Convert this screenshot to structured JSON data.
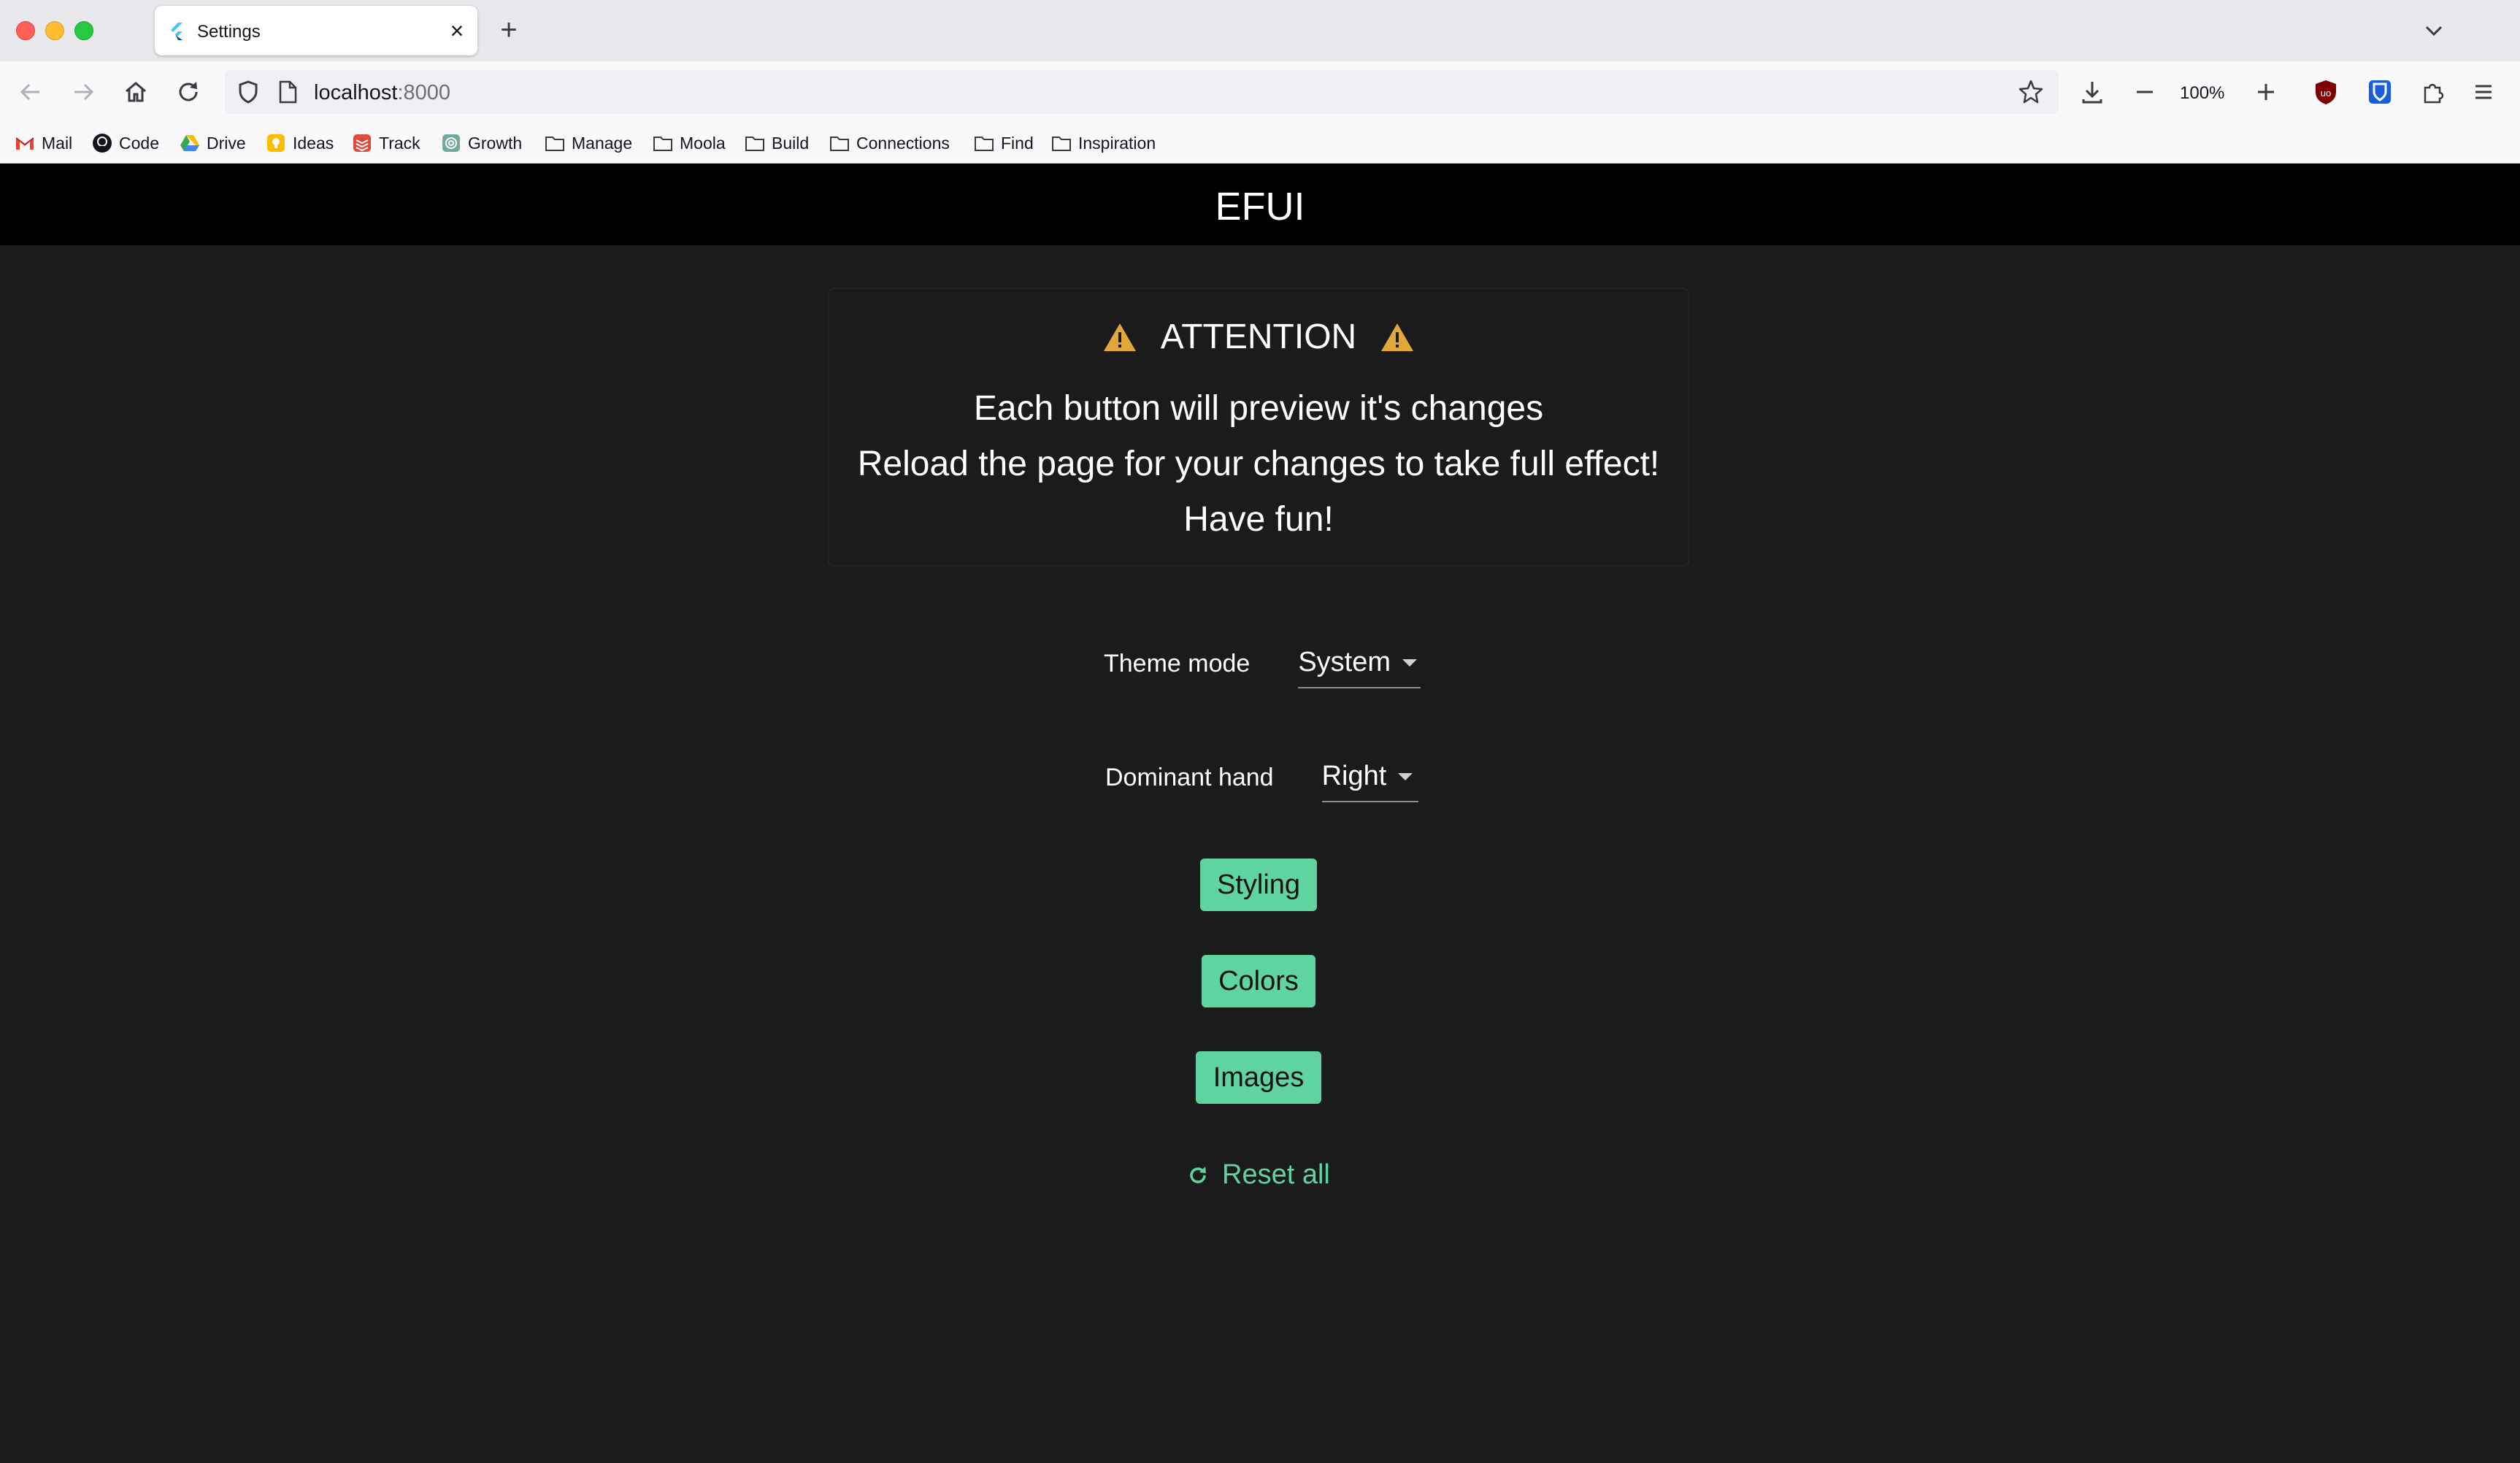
{
  "browser": {
    "tab_title": "Settings",
    "url_host": "localhost",
    "url_port": ":8000",
    "zoom": "100%",
    "bookmarks": [
      "Mail",
      "Code",
      "Drive",
      "Ideas",
      "Track",
      "Growth",
      "Manage",
      "Moola",
      "Build",
      "Connections",
      "Find",
      "Inspiration"
    ]
  },
  "app": {
    "title": "EFUI"
  },
  "attention": {
    "title": "ATTENTION",
    "lines": [
      "Each button will preview it's changes",
      "Reload the page for your changes to take full effect!",
      "Have fun!"
    ]
  },
  "settings": {
    "theme_mode_label": "Theme mode",
    "theme_mode_value": "System",
    "dominant_hand_label": "Dominant hand",
    "dominant_hand_value": "Right"
  },
  "buttons": {
    "styling": "Styling",
    "colors": "Colors",
    "images": "Images",
    "reset_all": "Reset all"
  },
  "colors": {
    "accent": "#5fd4a0",
    "background": "#1b1b1b",
    "app_bar": "#000000",
    "warning": "#e0a73a"
  }
}
